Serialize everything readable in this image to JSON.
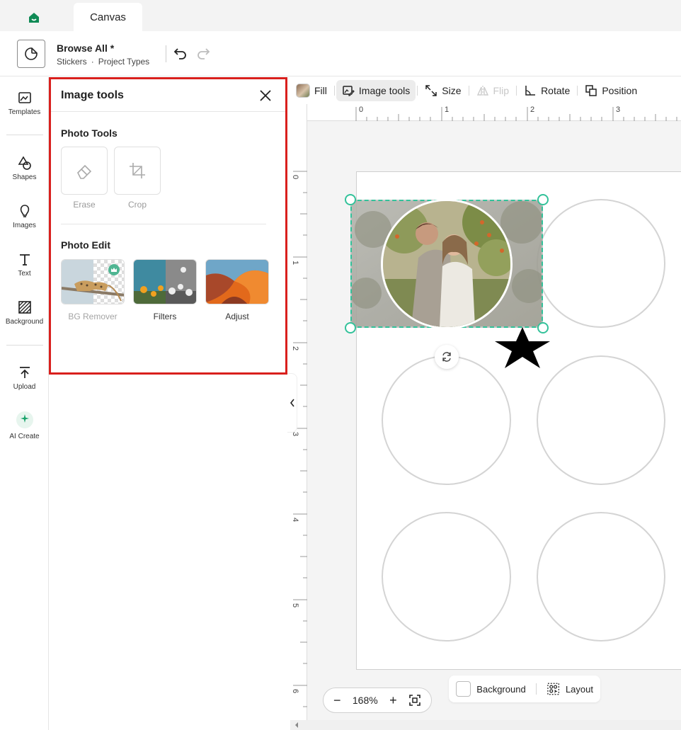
{
  "tabs": {
    "home_icon": "home-icon",
    "active_tab": "Canvas"
  },
  "header": {
    "project_title": "Browse All *",
    "breadcrumb": [
      "Stickers",
      "Project Types"
    ],
    "breadcrumb_separator": "·"
  },
  "rail": {
    "items": [
      {
        "label": "Templates",
        "icon": "templates-icon"
      },
      {
        "label": "Shapes",
        "icon": "shapes-icon"
      },
      {
        "label": "Images",
        "icon": "images-icon"
      },
      {
        "label": "Text",
        "icon": "text-icon"
      },
      {
        "label": "Background",
        "icon": "background-icon"
      },
      {
        "label": "Upload",
        "icon": "upload-icon"
      },
      {
        "label": "AI Create",
        "icon": "ai-sparkle-icon"
      }
    ]
  },
  "panel": {
    "title": "Image tools",
    "photo_tools_title": "Photo Tools",
    "photo_tools": [
      {
        "label": "Erase",
        "icon": "eraser-icon"
      },
      {
        "label": "Crop",
        "icon": "crop-icon"
      }
    ],
    "photo_edit_title": "Photo Edit",
    "photo_edit": [
      {
        "label": "BG Remover",
        "icon": "crown-icon"
      },
      {
        "label": "Filters"
      },
      {
        "label": "Adjust"
      }
    ]
  },
  "toolbar": {
    "items": [
      {
        "label": "Fill"
      },
      {
        "label": "Image tools"
      },
      {
        "label": "Size"
      },
      {
        "label": "Flip"
      },
      {
        "label": "Rotate"
      },
      {
        "label": "Position"
      }
    ]
  },
  "rulers": {
    "top": [
      "0",
      "1",
      "2",
      "3"
    ],
    "left": [
      "0",
      "1",
      "2",
      "3",
      "4",
      "5",
      "6"
    ]
  },
  "zoom": {
    "minus": "−",
    "value": "168%",
    "plus": "+"
  },
  "bottom_bar": {
    "background_label": "Background",
    "layout_label": "Layout"
  },
  "colors": {
    "accent": "#33c29a",
    "brand": "#0f8a55",
    "highlight_border": "#d9201d"
  }
}
